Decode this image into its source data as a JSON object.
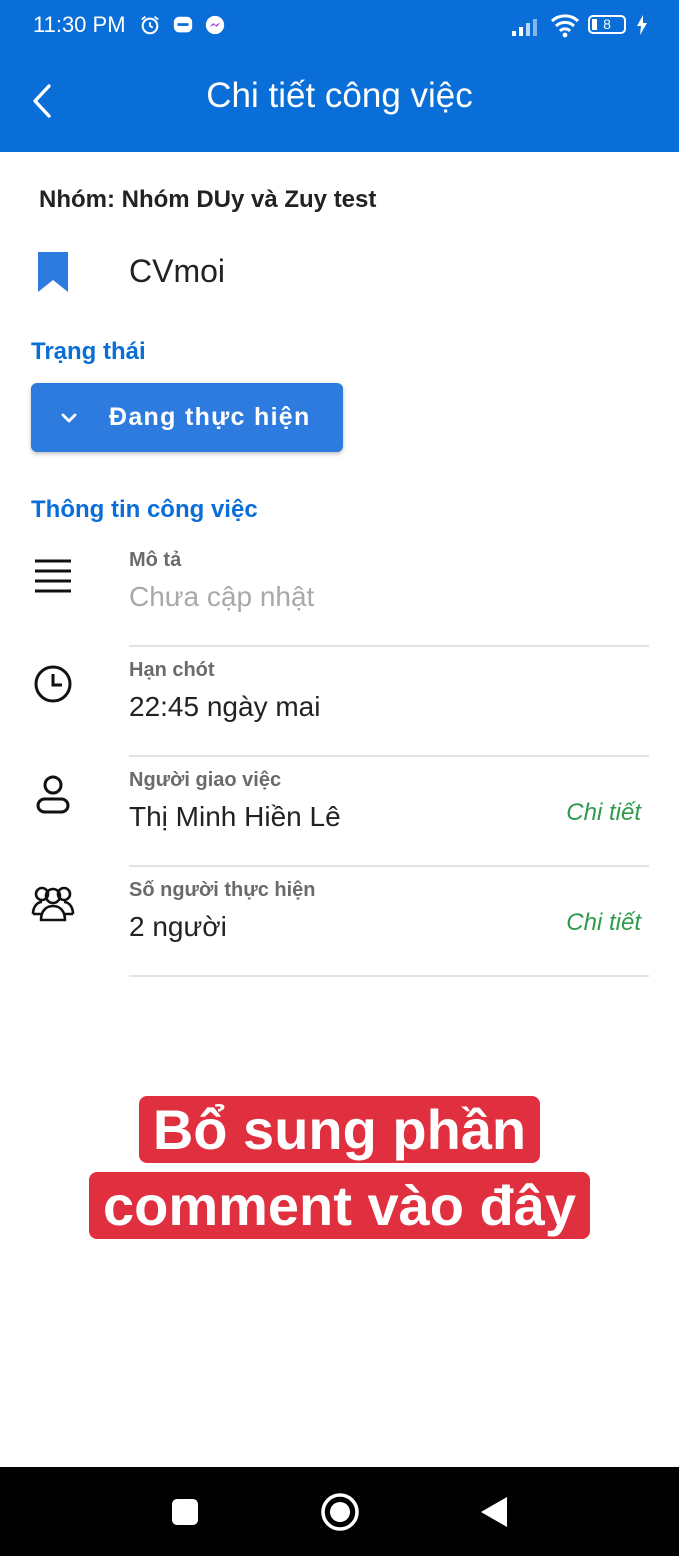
{
  "status_bar": {
    "time": "11:30 PM",
    "battery": "8"
  },
  "appbar": {
    "title": "Chi tiết công việc"
  },
  "task": {
    "group_line": "Nhóm: Nhóm DUy và Zuy test",
    "name": "CVmoi"
  },
  "status_section": {
    "title": "Trạng thái",
    "value": "Đang thực hiện"
  },
  "info_section": {
    "title": "Thông tin công việc",
    "rows": [
      {
        "label": "Mô tả",
        "value": "Chưa cập nhật",
        "icon": "menu-lines-icon"
      },
      {
        "label": "Hạn chót",
        "value": "22:45 ngày mai",
        "icon": "clock-icon"
      },
      {
        "label": "Người giao việc",
        "value": "Thị Minh Hiền Lê",
        "detail": "Chi tiết",
        "icon": "person-icon"
      },
      {
        "label": "Số người thực hiện",
        "value": "2 người",
        "detail": "Chi tiết",
        "icon": "people-icon"
      }
    ]
  },
  "annotation": {
    "line1": "Bổ sung phần",
    "line2": "comment vào đây"
  },
  "colors": {
    "primary": "#0a6ed8",
    "status_button": "#2d7bdf",
    "detail_link": "#2e9a4c",
    "annotation_bg": "#e0303f"
  }
}
